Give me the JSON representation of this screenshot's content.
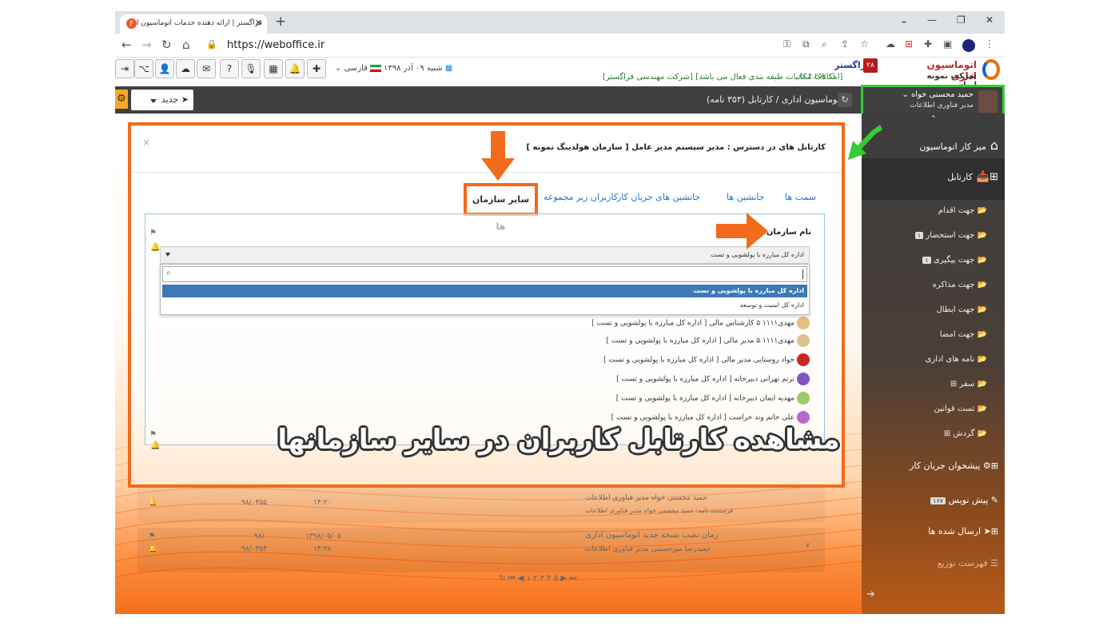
{
  "browser": {
    "tab_title": "فراگستر | ارائه دهنده خدمات اتوماسیون اد",
    "url": "https://weboffice.ir"
  },
  "header": {
    "logo_title": "اتوماسیون اداری",
    "logo_subtitle": "شرکت نمونه ایران",
    "badge_count": "۲۸",
    "app_name": "فراگستر",
    "version": "(۶.۴.۲۵۷.۱)",
    "notice": "[شرکت مهندسی فراگستر] [امکانات مکاتبات طبقه بندی فعال می باشد]",
    "date": "شنبه ۰۹ آذر ۱۳۹۸",
    "language": "فارسی"
  },
  "toolbar": {
    "new_label": "جدید",
    "breadcrumb": "اتوماسیون اداری  /  کارتابل (۳۵۳ نامه)"
  },
  "user": {
    "name": "حمید محسنی خواه",
    "role": "مدیر فناوری اطلاعات"
  },
  "sidebar": {
    "items": [
      {
        "label": "میز کار اتوماسیون"
      },
      {
        "label": "کارتابل"
      },
      {
        "label": "جهت اقدام"
      },
      {
        "label": "جهت استحضار",
        "count": "۱"
      },
      {
        "label": "جهت پیگیری",
        "count": "۱"
      },
      {
        "label": "جهت مذاکره"
      },
      {
        "label": "جهت ابطال"
      },
      {
        "label": "جهت امضا"
      },
      {
        "label": "نامه های اداری"
      },
      {
        "label": "سفر"
      },
      {
        "label": "تست قوانین"
      },
      {
        "label": "گردش"
      },
      {
        "label": "پیشخوان جریان کار"
      },
      {
        "label": "پیش نویس",
        "count": "۱۶۷"
      },
      {
        "label": "ارسال شده ها"
      },
      {
        "label": "فهرست توزیع"
      }
    ]
  },
  "modal": {
    "title": "کارتابل های در دسترس : مدیر سیستم مدیر عامل [ سازمان هولدینگ نمونه ]",
    "tabs": [
      "سمت ها",
      "جانشین ها",
      "جانشین های جریان کار",
      "کاربران زیر مجموعه",
      "سایر سازمان ها"
    ],
    "org_label": "نام سازمان",
    "selected_org": "اداره کل مبارزه با پولشویی و تست",
    "options": [
      "اداره کل مبارزه با پولشویی و تست",
      "اداره کل امنیت و توسعه"
    ],
    "users": [
      "مهدی۱۱۱۱ ۵ کارشناس مالی [ اداره کل مبارزه با پولشویی و تست ]",
      "مهدی۱۱۱۱ ۵ مدیر مالی [ اداره کل مبارزه با پولشویی و تست ]",
      "جواد روستایی مدیر مالی [ اداره کل مبارزه با پولشویی و تست ]",
      "ترنم تهرانی دبیرخانه [ اداره کل مبارزه با پولشویی و تست ]",
      "مهدیه ایمان دبیرخانه [ اداره کل مبارزه با پولشویی و تست ]",
      "علی حاتم وند خراست [ اداره کل مبارزه با پولشویی و تست ]"
    ]
  },
  "background_rows": {
    "row1_sender": "حمید محسنی خواه مدیر فناوری اطلاعات",
    "row1_meta": "فرستنده نامه: حمید محسنی خواه مدیر فناوری اطلاعات",
    "row1_time": "۱۴:۲۰",
    "row1_num": "۹۸/۰۴۵۵",
    "row2_subject": "زمان نصب نسخه جدید اتوماسیون اداری",
    "row2_sender": "حمیدرضا میرحسینی مدیر فناوری اطلاعات",
    "row2_date": "۱۳۹۸/۰۵/۰۵",
    "row2_time": "۱۴:۳۸",
    "row2_num1": "۹۸/",
    "row2_num2": "۹۸/۰۳۵۴",
    "row2_index": "۷"
  },
  "overlay_caption": "مشاهده کارتابل کاربران در سایر سازمانها",
  "colors": {
    "highlight_orange": "#f26a1b",
    "user_box_green": "#33cc33",
    "dark_bar": "#404040"
  }
}
